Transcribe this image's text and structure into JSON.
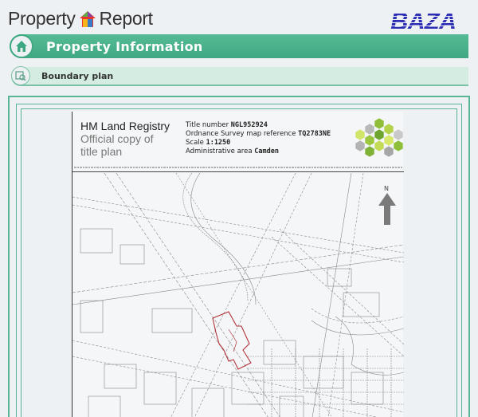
{
  "header": {
    "brand_left": "Property",
    "brand_right": "Report",
    "partner_logo": "BAZA"
  },
  "sections": {
    "info_title": "Property Information",
    "boundary_title": "Boundary plan"
  },
  "document": {
    "registry_title": "HM Land Registry",
    "registry_subtitle_line1": "Official copy of",
    "registry_subtitle_line2": "title plan",
    "title_number_label": "Title number",
    "title_number": "NGL952924",
    "os_ref_label": "Ordnance Survey map reference",
    "os_ref": "TQ2783NE",
    "scale_label": "Scale",
    "scale": "1:1250",
    "admin_label": "Administrative area",
    "admin_area": "Camden",
    "north_label": "N"
  },
  "colors": {
    "accent": "#3fa882",
    "accent_light": "#d5ece2",
    "baza": "#2c2fb4",
    "boundary": "#b5333a"
  },
  "icons": {
    "info": "home-icon",
    "boundary": "map-search-icon"
  }
}
